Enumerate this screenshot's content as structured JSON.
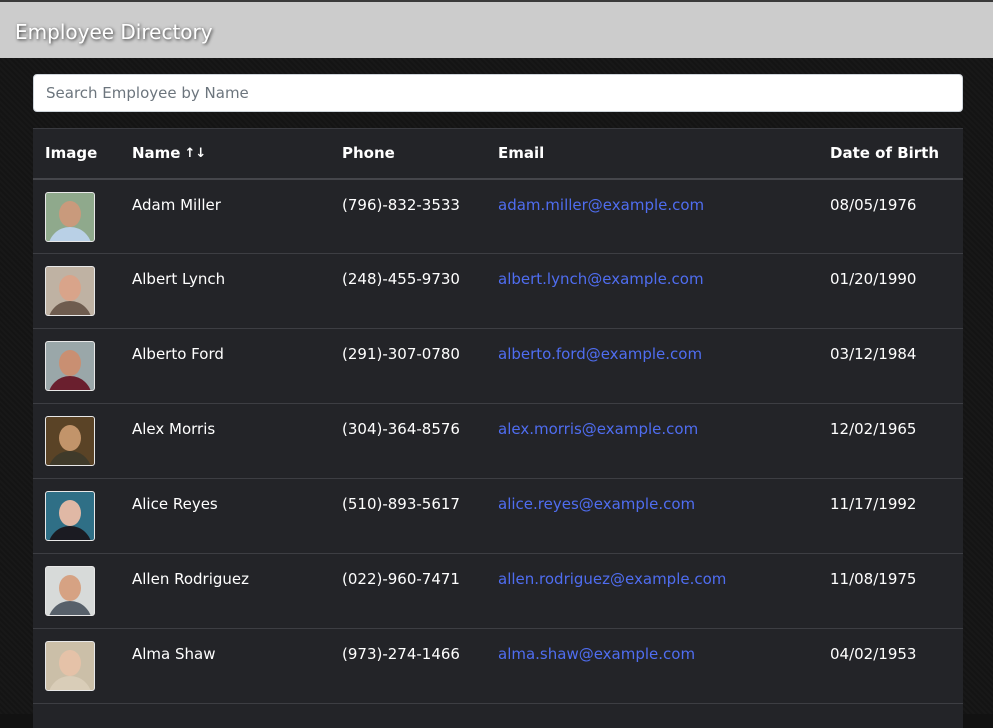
{
  "header": {
    "title": "Employee Directory"
  },
  "search": {
    "placeholder": "Search Employee by Name"
  },
  "table": {
    "columns": {
      "image": "Image",
      "name": "Name",
      "phone": "Phone",
      "email": "Email",
      "dob": "Date of Birth"
    },
    "sort_icon": "↑↓",
    "rows": [
      {
        "name": "Adam Miller",
        "phone": "(796)-832-3533",
        "email": "adam.miller@example.com",
        "dob": "08/05/1976"
      },
      {
        "name": "Albert Lynch",
        "phone": "(248)-455-9730",
        "email": "albert.lynch@example.com",
        "dob": "01/20/1990"
      },
      {
        "name": "Alberto Ford",
        "phone": "(291)-307-0780",
        "email": "alberto.ford@example.com",
        "dob": "03/12/1984"
      },
      {
        "name": "Alex Morris",
        "phone": "(304)-364-8576",
        "email": "alex.morris@example.com",
        "dob": "12/02/1965"
      },
      {
        "name": "Alice Reyes",
        "phone": "(510)-893-5617",
        "email": "alice.reyes@example.com",
        "dob": "11/17/1992"
      },
      {
        "name": "Allen Rodriguez",
        "phone": "(022)-960-7471",
        "email": "allen.rodriguez@example.com",
        "dob": "11/08/1975"
      },
      {
        "name": "Alma Shaw",
        "phone": "(973)-274-1466",
        "email": "alma.shaw@example.com",
        "dob": "04/02/1953"
      }
    ]
  },
  "colors": {
    "link": "#4f6df0",
    "header_bar": "#cccccc",
    "table_bg": "#232428"
  }
}
